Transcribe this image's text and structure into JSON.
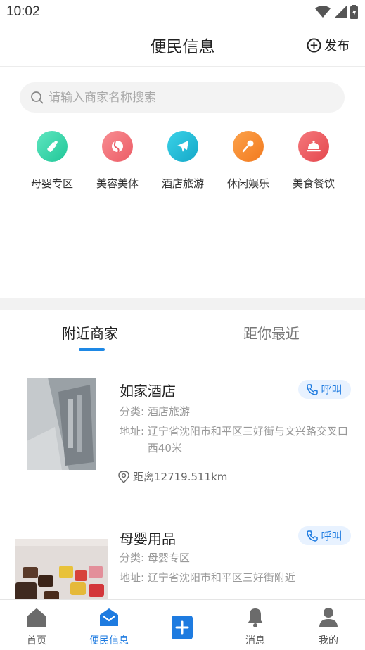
{
  "status_bar": {
    "time": "10:02"
  },
  "header": {
    "title": "便民信息",
    "publish_label": "发布"
  },
  "search": {
    "placeholder": "请输入商家名称搜索"
  },
  "categories": [
    {
      "label": "母婴专区",
      "icon": "baby-bottle-icon",
      "color": "#2ed3a5"
    },
    {
      "label": "美容美体",
      "icon": "beauty-face-icon",
      "color": "#f26b73"
    },
    {
      "label": "酒店旅游",
      "icon": "airplane-icon",
      "color": "#22b8d3"
    },
    {
      "label": "休闲娱乐",
      "icon": "microphone-icon",
      "color": "#f7892b"
    },
    {
      "label": "美食餐饮",
      "icon": "food-cloche-icon",
      "color": "#ec5a5e"
    }
  ],
  "tabs": [
    {
      "label": "附近商家",
      "active": true
    },
    {
      "label": "距你最近",
      "active": false
    }
  ],
  "listings": [
    {
      "name": "如家酒店",
      "category_label": "分类:",
      "category": "酒店旅游",
      "address_label": "地址:",
      "address": "辽宁省沈阳市和平区三好街与文兴路交叉口西40米",
      "distance": "距离12719.511km",
      "call_label": "呼叫"
    },
    {
      "name": "母婴用品",
      "category_label": "分类:",
      "category": "母婴专区",
      "address_label": "地址:",
      "address": "辽宁省沈阳市和平区三好街附近",
      "call_label": "呼叫"
    }
  ],
  "bottom_nav": [
    {
      "label": "首页",
      "icon": "home-icon",
      "active": false
    },
    {
      "label": "便民信息",
      "icon": "mail-icon",
      "active": true
    },
    {
      "label": "",
      "icon": "plus-icon",
      "active": false
    },
    {
      "label": "消息",
      "icon": "bell-icon",
      "active": false
    },
    {
      "label": "我的",
      "icon": "person-icon",
      "active": false
    }
  ],
  "colors": {
    "accent": "#1e7be0",
    "call_bg": "#e8f2ff"
  }
}
